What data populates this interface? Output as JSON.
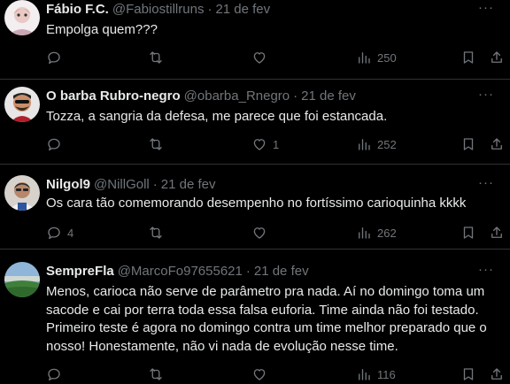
{
  "tweets": [
    {
      "name": "Fábio F.C.",
      "handle": "@Fabiostillruns",
      "sep": "·",
      "date": "21 de fev",
      "text": "Empolga quem???",
      "replies": "",
      "retweets": "",
      "likes": "",
      "views": "250"
    },
    {
      "name": "O barba Rubro-negro",
      "handle": "@obarba_Rnegro",
      "sep": "·",
      "date": "21 de fev",
      "text": "Tozza, a sangria da defesa, me parece que foi estancada.",
      "replies": "",
      "retweets": "",
      "likes": "1",
      "views": "252"
    },
    {
      "name": "Nilgol9",
      "handle": "@NillGoll",
      "sep": "·",
      "date": "21 de fev",
      "text": "Os cara tão comemorando desempenho no fortíssimo carioquinha kkkk",
      "replies": "4",
      "retweets": "",
      "likes": "",
      "views": "262"
    },
    {
      "name": "SempreFla",
      "handle": "@MarcoFo97655621",
      "sep": "·",
      "date": "21 de fev",
      "text": "Menos, carioca não serve de parâmetro pra nada. Aí no domingo toma um sacode e cai por terra toda essa falsa euforia. Time ainda não foi testado. Primeiro teste é agora no domingo contra um time melhor preparado que o nosso! Honestamente, não vi nada de evolução nesse time.",
      "replies": "",
      "retweets": "",
      "likes": "",
      "views": "116"
    }
  ],
  "more_label": "···",
  "icons": [
    "reply-icon",
    "retweet-icon",
    "like-icon",
    "views-icon",
    "bookmark-icon",
    "share-icon",
    "more-icon"
  ],
  "colors": {
    "background": "#000000",
    "text": "#e7e9ea",
    "muted": "#71767b",
    "divider": "#2f3336"
  }
}
